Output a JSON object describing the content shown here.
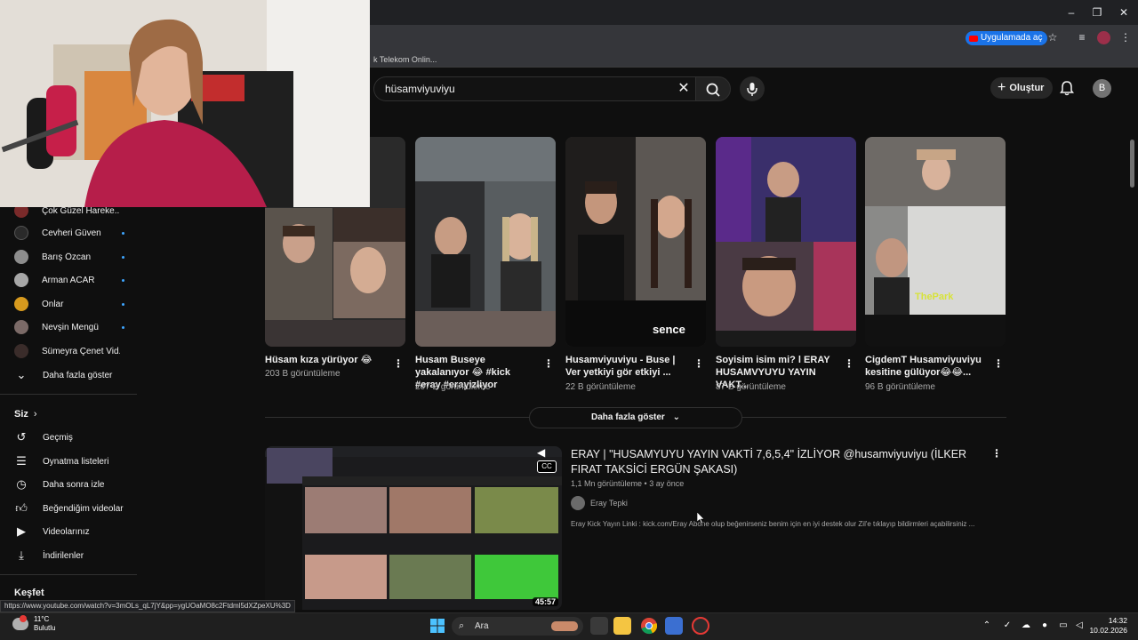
{
  "browser": {
    "open_in_app_label": "Uygulamada aç",
    "bookmark_label": "k Telekom Onlin..."
  },
  "header": {
    "search_value": "hüsamviyuviyu",
    "create_label": "Oluştur",
    "avatar_letter": "B"
  },
  "sidebar": {
    "subscriptions": [
      {
        "name": "Çok Güzel Hareke...",
        "color": "#7a2a2a"
      },
      {
        "name": "Cevheri Güven",
        "color": "#2a2a2a"
      },
      {
        "name": "Barış Özcan",
        "color": "#8d8d8d"
      },
      {
        "name": "Arman ACAR",
        "color": "#a7a7a7"
      },
      {
        "name": "Onlar",
        "color": "#d79a1e"
      },
      {
        "name": "Nevşin Mengü",
        "color": "#7b6a67"
      },
      {
        "name": "Sümeyra Çenet Vid...",
        "color": "#3a2c2a"
      }
    ],
    "show_more": "Daha fazla göster",
    "you_section": "Siz",
    "you_items": [
      {
        "label": "Geçmiş",
        "icon": "history-icon"
      },
      {
        "label": "Oynatma listeleri",
        "icon": "playlists-icon"
      },
      {
        "label": "Daha sonra izle",
        "icon": "watch-later-icon"
      },
      {
        "label": "Beğendiğim videolar",
        "icon": "liked-videos-icon"
      },
      {
        "label": "Videolarınız",
        "icon": "your-videos-icon"
      },
      {
        "label": "İndirilenler",
        "icon": "downloads-icon"
      }
    ],
    "explore_section": "Keşfet"
  },
  "shorts": [
    {
      "title": "Hüsam kıza yürüyor 😂",
      "views": "203 B görüntüleme"
    },
    {
      "title": "Husam Buseye yakalanıyor 😂 #kick #eray #erayizliyor",
      "views": "207 B görüntüleme"
    },
    {
      "title": "Husamviyuviyu - Buse | Ver yetkiyi gör etkiyi ...",
      "views": "22 B görüntüleme",
      "overlay": "sence"
    },
    {
      "title": "Soyisim isim mi? l ERAY HUSAMVYUYU YAYIN VAKT...",
      "views": "87 B görüntüleme"
    },
    {
      "title": "CigdemT Husamviyuviyu kesitine gülüyor😂😂...",
      "views": "96 B görüntüleme",
      "overlay": "ThePark"
    }
  ],
  "shelf_more_label": "Daha fazla göster",
  "video": {
    "title": "ERAY | \"HUSAMYUYU YAYIN VAKTİ 7,6,5,4\" İZLİYOR @husamviyuviyu (İLKER FIRAT TAKSİCİ ERGÜN ŞAKASI)",
    "meta": "1,1 Mn görüntüleme • 3 ay önce",
    "channel": "Eray Tepki",
    "description": "Eray Kick Yayın Linki : kick.com/Eray Abone olup beğenirseniz benim için en iyi destek olur Zil'e tıklayıp bildirmleri açabilirsiniz ...",
    "duration": "45:57",
    "cc": "CC"
  },
  "status_url": "https://www.youtube.com/watch?v=3mOLs_qL7jY&pp=ygUOaMO8c2Ftdml5dXZpeXU%3D",
  "taskbar": {
    "temperature": "11°C",
    "weather": "Bulutlu",
    "search_label": "Ara",
    "time": "14:32",
    "date": "10.02.2026"
  }
}
